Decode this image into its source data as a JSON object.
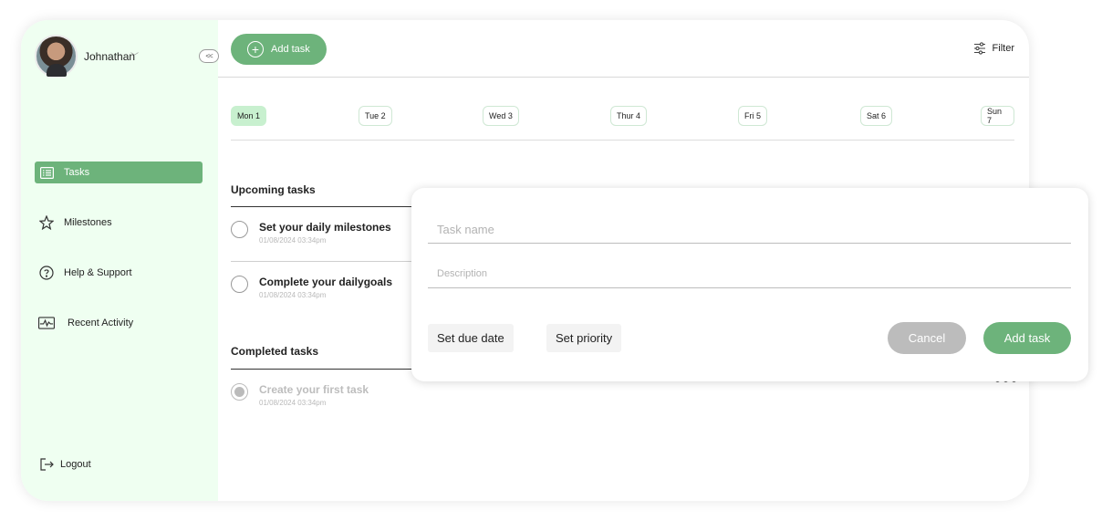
{
  "user": {
    "name": "Johnathan",
    "chevron": "﹀",
    "collapse_label": "<<"
  },
  "sidebar": {
    "items": [
      {
        "label": "Tasks",
        "icon": "list-icon",
        "active": true
      },
      {
        "label": "Milestones",
        "icon": "star-icon",
        "active": false
      },
      {
        "label": "Help & Support",
        "icon": "help-icon",
        "active": false
      },
      {
        "label": "Recent Activity",
        "icon": "activity-icon",
        "active": false
      }
    ],
    "logout_label": "Logout"
  },
  "header": {
    "add_task_label": "Add task",
    "filter_label": "Filter"
  },
  "days": [
    "Mon 1",
    "Tue 2",
    "Wed 3",
    "Thur 4",
    "Fri 5",
    "Sat 6",
    "Sun 7"
  ],
  "upcoming": {
    "title": "Upcoming tasks",
    "tasks": [
      {
        "title": "Set your daily milestones",
        "date": "01/08/2024  03:34pm"
      },
      {
        "title": "Complete your dailygoals",
        "date": "01/08/2024  03:34pm"
      }
    ]
  },
  "completed": {
    "title": "Completed tasks",
    "tasks": [
      {
        "title": "Create your first task",
        "date": "01/08/2024  03:34pm"
      }
    ]
  },
  "modal": {
    "task_name_placeholder": "Task name",
    "description_placeholder": "Description",
    "due_date_label": "Set due date",
    "priority_label": "Set priority",
    "cancel_label": "Cancel",
    "add_label": "Add task"
  },
  "colors": {
    "accent": "#6db37b",
    "sidebar_bg": "#effff1",
    "day_active": "#c8f0cf",
    "cancel": "#bcbcbc"
  }
}
